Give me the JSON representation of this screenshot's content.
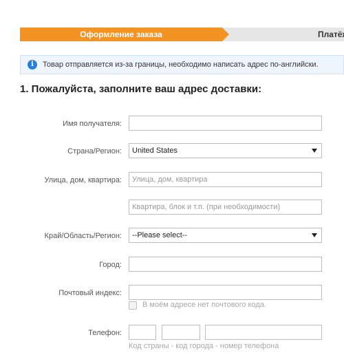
{
  "steps": {
    "active": "Оформление заказа",
    "next": "Платёж"
  },
  "notice": {
    "icon": "info-icon",
    "text": "Товар отправляется из-за границы, необходимо написать адрес по-английски."
  },
  "section_title": "1. Пожалуйста, заполните ваш адрес доставки:",
  "form": {
    "recipient_label": "Имя получателя:",
    "recipient_value": "",
    "country_label": "Страна/Регион:",
    "country_value": "United States",
    "street_label": "Улица, дом, квартира:",
    "street_placeholder": "Улица, дом, квартира",
    "apartment_placeholder": "Квартира, блок и т.п. (при необходимости)",
    "state_label": "Край/Область/Регион:",
    "state_value": "--Please select--",
    "city_label": "Город:",
    "city_value": "",
    "zip_label": "Почтовый индекс:",
    "zip_value": "",
    "no_zip_label": "В моём адресе нет почтового кода.",
    "phone_label": "Телефон:",
    "phone_hint": "Код страны - код города - номер телефона"
  },
  "colors": {
    "accent": "#f39323",
    "info": "#2a7fd8"
  }
}
